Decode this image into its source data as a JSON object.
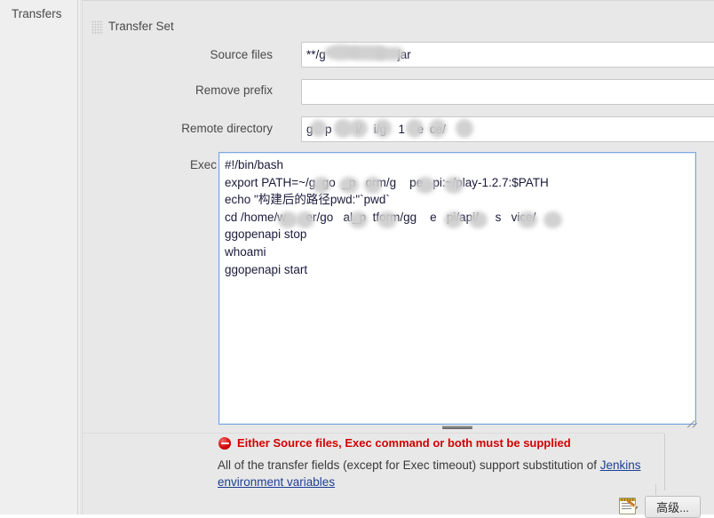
{
  "left_panel": {
    "label": "Transfers"
  },
  "panel": {
    "title": "Transfer Set",
    "grip_icon": "drag-grip-icon"
  },
  "fields": {
    "source_files": {
      "label": "Source files",
      "value_prefix": "**/g",
      "value_suffix": "jar",
      "redacted": true
    },
    "remove_prefix": {
      "label": "Remove prefix",
      "value": "",
      "placeholder": ""
    },
    "remote_directory": {
      "label": "Remote directory",
      "value_parts": [
        "g",
        "p",
        "i/",
        "i/g",
        "1",
        "e",
        "ce/"
      ],
      "redacted": true
    },
    "exec_command": {
      "label": "Exec command",
      "lines": [
        "#!/bin/bash",
        "export PATH=~/g  go  _p   orm/g    pe   pi:~/play-1.2.7:$PATH",
        "echo \"构建后的路径pwd:\"`pwd`",
        "cd /home/w      er/go   al_p  tform/gg    e   pi/api/     s   vice/",
        "ggopenapi stop",
        "whoami",
        "ggopenapi start"
      ],
      "redacted": true
    }
  },
  "validation": {
    "error_icon": "error-circle-icon",
    "error_message": "Either Source files, Exec command or both must be supplied",
    "error_color": "#d40000"
  },
  "help": {
    "text_before_link": "All of the transfer fields (except for Exec timeout) support substitution of ",
    "link_text": "Jenkins environment variables",
    "link_color": "#1c3f94"
  },
  "help_icons": [
    {
      "name": "help-icon-source-files",
      "glyph": "?"
    },
    {
      "name": "help-icon-remove-prefix",
      "glyph": "?"
    },
    {
      "name": "help-icon-remote-directory",
      "glyph": "?"
    },
    {
      "name": "help-icon-exec-command",
      "glyph": "?"
    }
  ],
  "footer": {
    "note_icon": "notepad-pencil-icon",
    "advanced_button_label": "高级..."
  }
}
